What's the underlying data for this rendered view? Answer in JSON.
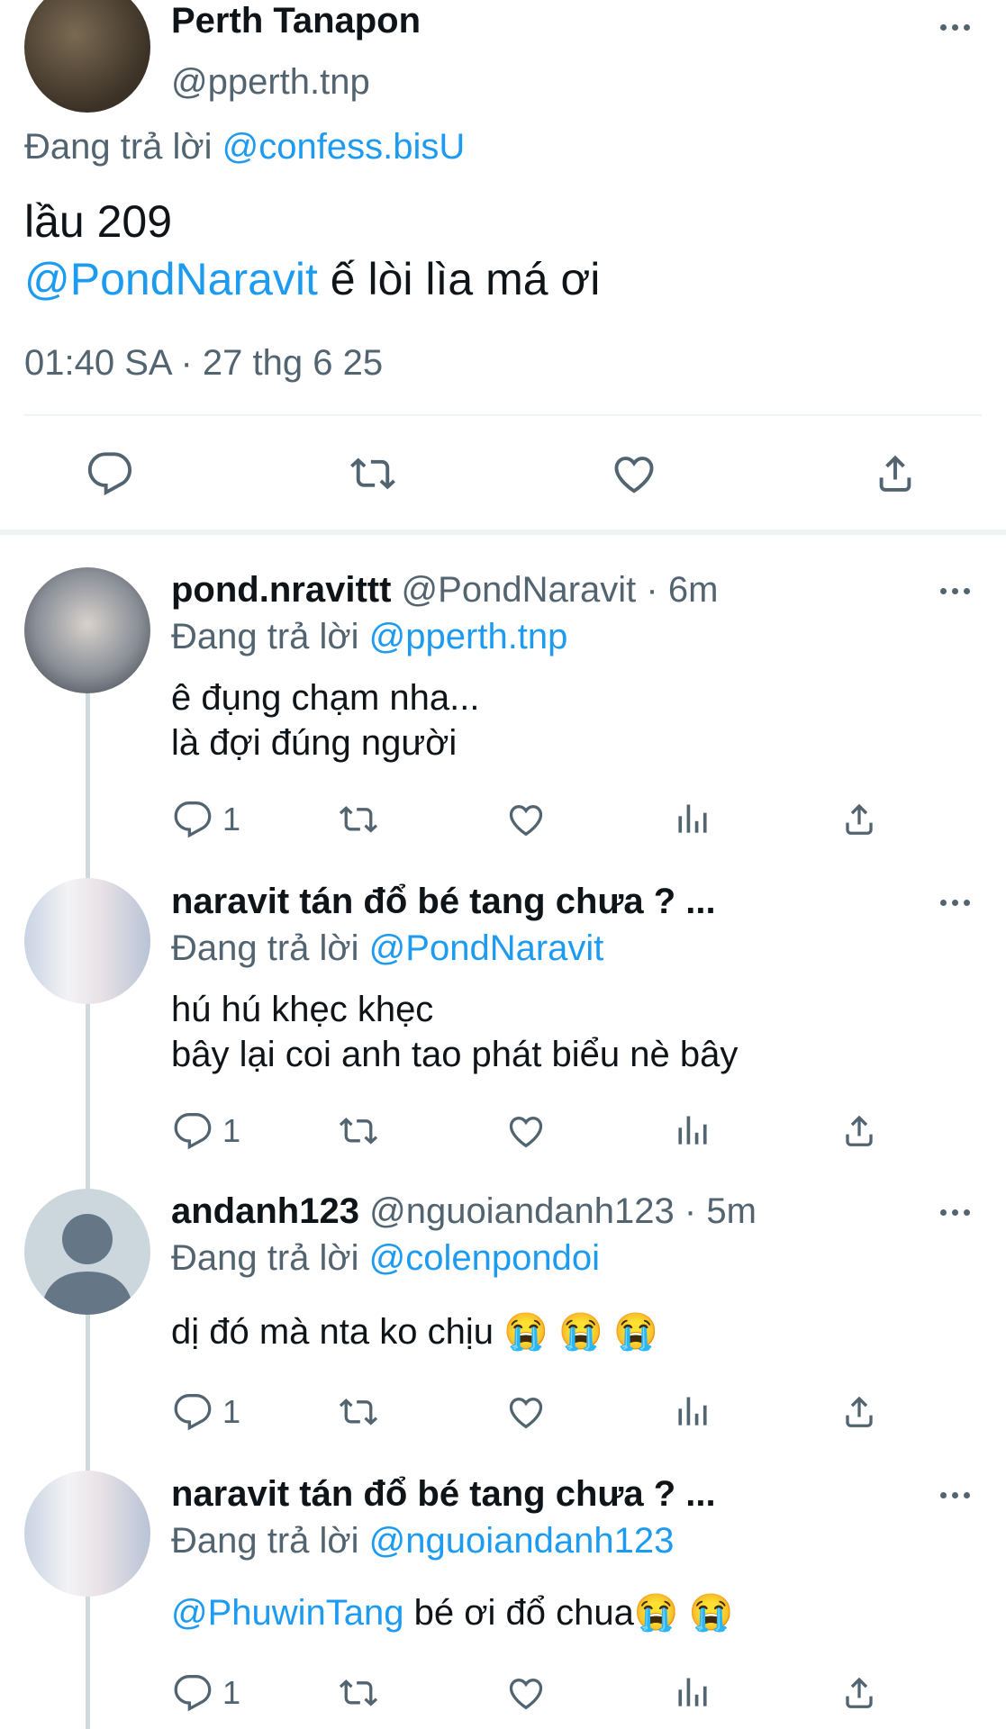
{
  "main_tweet": {
    "name": "Perth Tanapon",
    "handle": "@pperth.tnp",
    "reply_prefix": "Đang trả lời",
    "reply_to": "@confess.bisU",
    "line1": "lầu 209",
    "mention": "@PondNaravit",
    "line2_rest": " ế lòi lìa má ơi",
    "timestamp": "01:40 SA · 27 thg 6 25"
  },
  "replies": [
    {
      "name": "pond.nravittt",
      "handle": "@PondNaravit · 6m",
      "reply_prefix": "Đang trả lời",
      "reply_to": "@pperth.tnp",
      "text_line1": "ê đụng chạm nha...",
      "text_line2": "là đợi đúng người",
      "reply_count": "1"
    },
    {
      "name": "naravit tán đổ bé tang chưa ? ...",
      "reply_prefix": "Đang trả lời",
      "reply_to": "@PondNaravit",
      "text_line1": "hú hú khẹc khẹc",
      "text_line2": "bây lại coi anh tao phát biểu nè bây",
      "reply_count": "1"
    },
    {
      "name": "andanh123",
      "handle": "@nguoiandanh123 · 5m",
      "reply_prefix": "Đang trả lời",
      "reply_to": "@colenpondoi",
      "text_line1": "dị đó mà nta ko chịu 😭 😭 😭",
      "reply_count": "1"
    },
    {
      "name": "naravit tán đổ bé tang chưa ? ...",
      "reply_prefix": "Đang trả lời",
      "reply_to": "@nguoiandanh123",
      "mention": "@PhuwinTang",
      "text_rest": " bé ơi đổ chua😭 😭",
      "reply_count": "1"
    }
  ],
  "icons": [
    "comment-icon",
    "retweet-icon",
    "heart-icon",
    "share-icon",
    "views-icon",
    "more-icon"
  ],
  "colors": {
    "link": "#1d9bf0",
    "muted": "#536471",
    "text": "#0f1419",
    "divider": "#eff3f4"
  }
}
